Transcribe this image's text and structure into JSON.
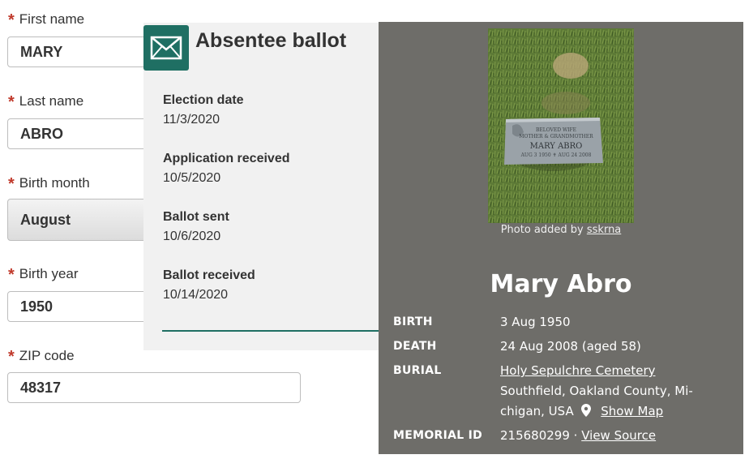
{
  "form": {
    "first_name": {
      "label": "First name",
      "value": "MARY"
    },
    "last_name": {
      "label": "Last name",
      "value": "ABRO"
    },
    "birth_month": {
      "label": "Birth month",
      "value": "August"
    },
    "birth_year": {
      "label": "Birth year",
      "value": "1950"
    },
    "zip": {
      "label": "ZIP code",
      "value": "48317"
    },
    "required_mark": "*"
  },
  "ballot": {
    "title": "Absentee ballot",
    "icon": "envelope-icon",
    "rows": [
      {
        "label": "Election date",
        "value": "11/3/2020"
      },
      {
        "label": "Application received",
        "value": "10/5/2020"
      },
      {
        "label": "Ballot sent",
        "value": "10/6/2020"
      },
      {
        "label": "Ballot received",
        "value": "10/14/2020"
      }
    ]
  },
  "memorial": {
    "photo_credit_prefix": "Photo added by ",
    "photo_credit_user": "sskrna",
    "headstone": {
      "line1": "BELOVED WIFE",
      "line2": "MOTHER & GRANDMOTHER",
      "name": "MARY ABRO",
      "dates": "AUG 3 1950 ✝ AUG 24 2008"
    },
    "name": "Mary Abro",
    "birth_label": "BIRTH",
    "birth_value": "3 Aug 1950",
    "death_label": "DEATH",
    "death_value": "24 Aug 2008 (aged 58)",
    "burial_label": "BURIAL",
    "burial_cemetery": "Holy Sepulchre Cemetery",
    "burial_loc_1": "Southfield, Oakland County, Mi-",
    "burial_loc_2": "chigan, USA",
    "show_map": "Show Map",
    "memorial_label": "MEMORIAL ID",
    "memorial_id": "215680299",
    "separator": " · ",
    "view_source": "View Source"
  },
  "colors": {
    "ballot_accent": "#1f6f63",
    "memorial_bg": "#6e6d69",
    "required": "#c0392b"
  }
}
